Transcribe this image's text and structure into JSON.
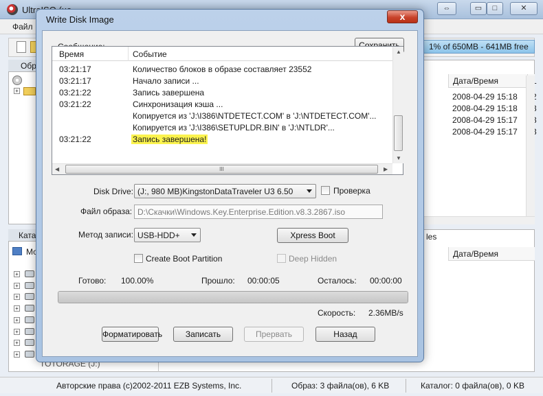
{
  "main": {
    "title": "UltraISO (не",
    "menu_file": "Файл",
    "capacity": "1% of 650MB - 641MB free",
    "tab_top": "Обра",
    "tab_bottom": "Катал",
    "columns_top": {
      "date": "Дата/Время",
      "l": "L"
    },
    "rows_top": [
      {
        "date": "2008-04-29 15:18",
        "n": "2"
      },
      {
        "date": "2008-04-29 15:18",
        "n": "3"
      },
      {
        "date": "2008-04-29 15:17",
        "n": "3"
      },
      {
        "date": "2008-04-29 15:17",
        "n": "3"
      }
    ],
    "bottom_tab_right": "les",
    "columns_bottom": {
      "date": "Дата/Время"
    },
    "tree_root": "Мой",
    "tree_last": "TOTORAGE (J:)"
  },
  "status": {
    "copyright": "Авторские права (c)2002-2011 EZB Systems, Inc.",
    "image": "Образ: 3 файла(ов), 6 KB",
    "catalog": "Каталог: 0 файла(ов), 0 KB"
  },
  "dialog": {
    "title": "Write Disk Image",
    "close": "x",
    "message_label": "Сообщение:",
    "save_button": "Сохранить",
    "log": {
      "col_time": "Время",
      "col_event": "Событие",
      "rows": [
        {
          "time": "03:21:17",
          "event": "Количество блоков в образе составляет 23552"
        },
        {
          "time": "03:21:17",
          "event": "Начало записи ..."
        },
        {
          "time": "03:21:22",
          "event": "Запись завершена"
        },
        {
          "time": "03:21:22",
          "event": "Синхронизация кэша ..."
        },
        {
          "time": "",
          "event": "Копируется из 'J:\\I386\\NTDETECT.COM' в 'J:\\NTDETECT.COM'..."
        },
        {
          "time": "",
          "event": "Копируется из 'J:\\I386\\SETUPLDR.BIN' в 'J:\\NTLDR'..."
        },
        {
          "time": "03:21:22",
          "event": "Запись завершена!"
        }
      ],
      "scroll_grip": "III"
    },
    "disk_drive_label": "Disk Drive:",
    "disk_drive_value": "(J:, 980 MB)KingstonDataTraveler U3 6.50",
    "verify_label": "Проверка",
    "image_file_label": "Файл образа:",
    "image_file_value": "D:\\Скачки\\Windows.Key.Enterprise.Edition.v8.3.2867.iso",
    "write_method_label": "Метод записи:",
    "write_method_value": "USB-HDD+",
    "xpress_boot": "Xpress Boot",
    "create_boot_partition": "Create Boot Partition",
    "deep_hidden": "Deep Hidden",
    "ready_label": "Готово:",
    "ready_value": "100.00%",
    "elapsed_label": "Прошло:",
    "elapsed_value": "00:00:05",
    "remaining_label": "Осталось:",
    "remaining_value": "00:00:00",
    "progress": 1.0,
    "speed_label": "Скорость:",
    "speed_value": "2.36MB/s",
    "buttons": {
      "format": "Форматировать",
      "write": "Записать",
      "abort": "Прервать",
      "back": "Назад"
    },
    "highlight_color": "#fbf34e"
  }
}
